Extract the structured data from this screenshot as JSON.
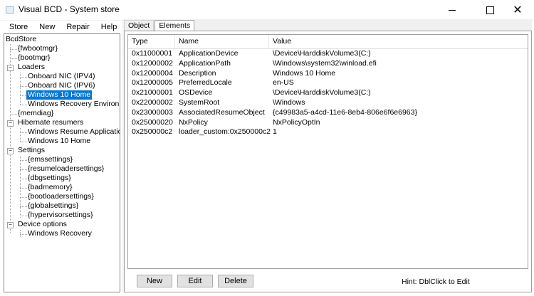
{
  "window": {
    "title": "Visual BCD - System store",
    "minimize_glyph": "",
    "close_glyph": "✕"
  },
  "menu": [
    "Store",
    "New",
    "Repair",
    "Help"
  ],
  "tree": {
    "root": "BcdStore",
    "fwbootmgr": "{fwbootmgr}",
    "bootmgr": "{bootmgr}",
    "loaders": "Loaders",
    "loader_items": [
      "Onboard NIC (IPV4)",
      "Onboard NIC (IPV6)",
      "Windows 10 Home",
      "Windows Recovery Environment"
    ],
    "selected": "Windows 10 Home",
    "memdiag": "{memdiag}",
    "hibernate": "Hibernate resumers",
    "hibernate_items": [
      "Windows Resume Application",
      "Windows 10 Home"
    ],
    "settings": "Settings",
    "settings_items": [
      "{emssettings}",
      "{resumeloadersettings}",
      "{dbgsettings}",
      "{badmemory}",
      "{bootloadersettings}",
      "{globalsettings}",
      "{hypervisorsettings}"
    ],
    "device_options": "Device options",
    "device_items": [
      "Windows Recovery"
    ],
    "collapse_glyph": "−"
  },
  "tabs": [
    "Object",
    "Elements"
  ],
  "active_tab": "Elements",
  "grid": {
    "columns": [
      "Type",
      "Name",
      "Value"
    ],
    "rows": [
      [
        "0x11000001",
        "ApplicationDevice",
        "\\Device\\HarddiskVolume3(C:)"
      ],
      [
        "0x12000002",
        "ApplicationPath",
        "\\Windows\\system32\\winload.efi"
      ],
      [
        "0x12000004",
        "Description",
        "Windows 10 Home"
      ],
      [
        "0x12000005",
        "PreferredLocale",
        "en-US"
      ],
      [
        "0x21000001",
        "OSDevice",
        "\\Device\\HarddiskVolume3(C:)"
      ],
      [
        "0x22000002",
        "SystemRoot",
        "\\Windows"
      ],
      [
        "0x23000003",
        "AssociatedResumeObject",
        "{c49983a5-a4cd-11e6-8eb4-806e6f6e6963}"
      ],
      [
        "0x25000020",
        "NxPolicy",
        "NxPolicyOptIn"
      ],
      [
        "0x250000c2",
        "loader_custom:0x250000c2",
        "1"
      ]
    ]
  },
  "buttons": {
    "new": "New",
    "edit": "Edit",
    "delete": "Delete"
  },
  "hint": "Hint: DblClick to Edit",
  "colors": {
    "selection": "#0078d7"
  }
}
